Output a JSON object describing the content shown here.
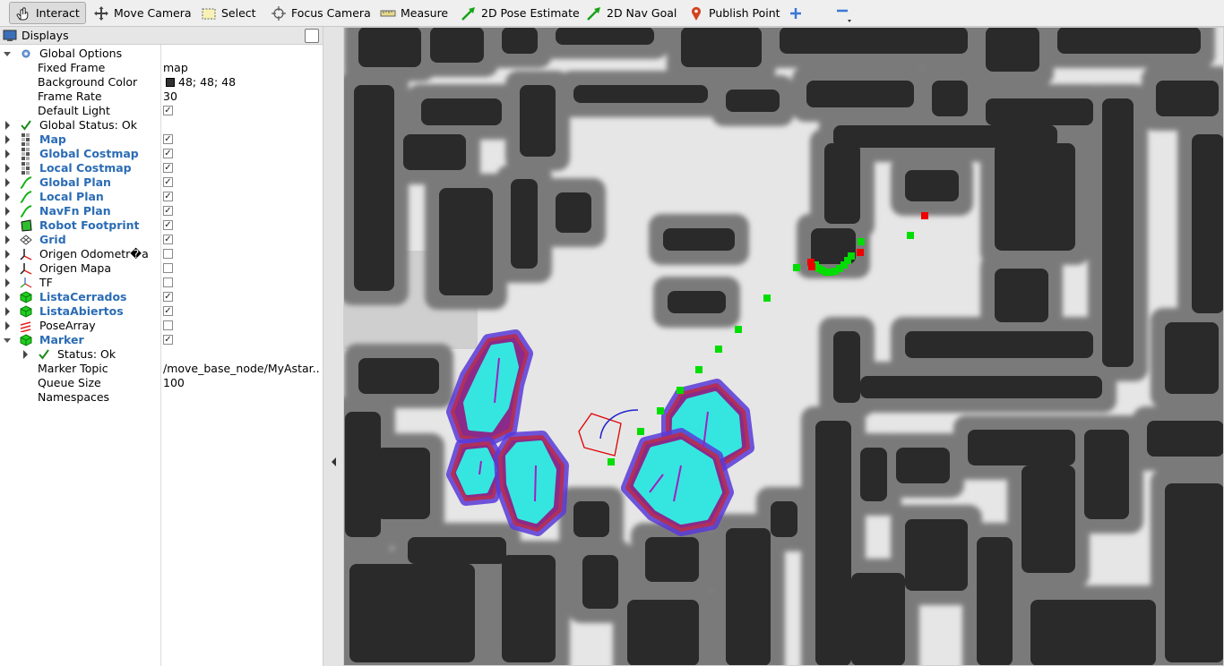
{
  "toolbar": {
    "tools": [
      {
        "label": "Interact",
        "icon": "hand-pointer-icon"
      },
      {
        "label": "Move Camera",
        "icon": "move-camera-icon"
      },
      {
        "label": "Select",
        "icon": "select-box-icon"
      },
      {
        "label": "Focus Camera",
        "icon": "crosshair-icon"
      },
      {
        "label": "Measure",
        "icon": "ruler-icon"
      },
      {
        "label": "2D Pose Estimate",
        "icon": "green-arrow-icon"
      },
      {
        "label": "2D Nav Goal",
        "icon": "green-arrow-icon"
      },
      {
        "label": "Publish Point",
        "icon": "map-pin-icon"
      }
    ],
    "add_icon": "plus-icon",
    "remove_icon": "minus-icon"
  },
  "displays": {
    "title": "Displays",
    "global_options": "Global Options",
    "properties": [
      {
        "label": "Fixed Frame",
        "value": "map"
      },
      {
        "label": "Background Color",
        "value": "48; 48; 48",
        "swatch": "#303030"
      },
      {
        "label": "Frame Rate",
        "value": "30"
      },
      {
        "label": "Default Light",
        "checked": true
      }
    ],
    "global_status": "Global Status: Ok",
    "items": [
      {
        "label": "Map",
        "checked": true,
        "icon": "map-icon"
      },
      {
        "label": "Global Costmap",
        "checked": true,
        "icon": "map-icon"
      },
      {
        "label": "Local Costmap",
        "checked": true,
        "icon": "map-icon"
      },
      {
        "label": "Global Plan",
        "checked": true,
        "icon": "path-icon"
      },
      {
        "label": "Local Plan",
        "checked": true,
        "icon": "path-icon"
      },
      {
        "label": "NavFn Plan",
        "checked": true,
        "icon": "path-icon"
      },
      {
        "label": "Robot Footprint",
        "checked": true,
        "icon": "polygon-icon"
      },
      {
        "label": "Grid",
        "checked": true,
        "icon": "grid-icon"
      },
      {
        "label": "Origen Odometr�a",
        "checked": false,
        "icon": "axes-icon"
      },
      {
        "label": "Origen Mapa",
        "checked": false,
        "icon": "axes-icon"
      },
      {
        "label": "TF",
        "checked": false,
        "icon": "tf-icon"
      },
      {
        "label": "ListaCerrados",
        "checked": true,
        "icon": "marker-cube-icon"
      },
      {
        "label": "ListaAbiertos",
        "checked": true,
        "icon": "marker-cube-icon"
      },
      {
        "label": "PoseArray",
        "checked": false,
        "icon": "pose-array-icon"
      },
      {
        "label": "Marker",
        "checked": true,
        "icon": "marker-cube-icon"
      }
    ],
    "marker_children": [
      {
        "label": "Status: Ok"
      },
      {
        "label": "Marker Topic",
        "value": "/move_base_node/MyAstar..."
      },
      {
        "label": "Queue Size",
        "value": "100"
      },
      {
        "label": "Namespaces",
        "value": ""
      }
    ]
  },
  "colors": {
    "blue_label": "#2b6cb5",
    "obstacle": "#2a2a2a",
    "inflation": "#7a7a7a",
    "local_costmap": "#35e6e0",
    "marker_green": "#00dd00",
    "marker_red": "#ee0000"
  }
}
